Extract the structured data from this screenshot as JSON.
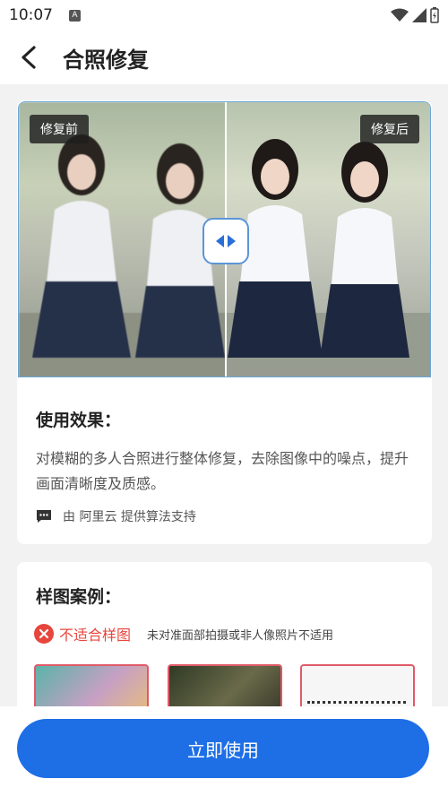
{
  "status_bar": {
    "time": "10:07",
    "notif_badge": "A"
  },
  "header": {
    "title": "合照修复"
  },
  "compare": {
    "before_label": "修复前",
    "after_label": "修复后"
  },
  "effect": {
    "title": "使用效果：",
    "description": "对模糊的多人合照进行整体修复，去除图像中的噪点，提升画面清晰度及质感。",
    "credit": "由 阿里云 提供算法支持"
  },
  "examples": {
    "title": "样图案例：",
    "unfit_label": "不适合样图",
    "unfit_note": "未对准面部拍摄或非人像照片不适用"
  },
  "cta": {
    "label": "立即使用"
  },
  "colors": {
    "accent": "#1e6fe6",
    "warning": "#e8453c"
  }
}
